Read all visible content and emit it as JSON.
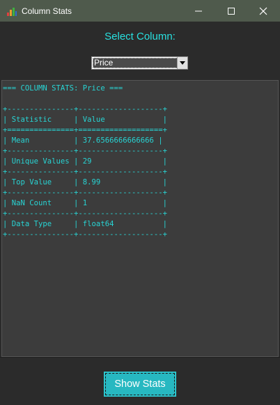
{
  "window": {
    "title": "Column Stats",
    "titlebar_color": "#4f5a4c"
  },
  "controls": {
    "minimize_icon": "minimize-icon",
    "maximize_icon": "maximize-icon",
    "close_icon": "close-icon"
  },
  "selector": {
    "label": "Select Column:",
    "selected_value": "Price"
  },
  "output": {
    "text": "=== COLUMN STATS: Price ===\n\n+---------------+-------------------+\n| Statistic     | Value             |\n+===============+===================+\n| Mean          | 37.6566666666666 |\n+---------------+-------------------+\n| Unique Values | 29                |\n+---------------+-------------------+\n| Top Value     | 8.99              |\n+---------------+-------------------+\n| NaN Count     | 1                 |\n+---------------+-------------------+\n| Data Type     | float64           |\n+---------------+-------------------+",
    "text_color": "#28d4d4"
  },
  "actions": {
    "show_stats_label": "Show Stats",
    "accent": "#27b8c1"
  }
}
